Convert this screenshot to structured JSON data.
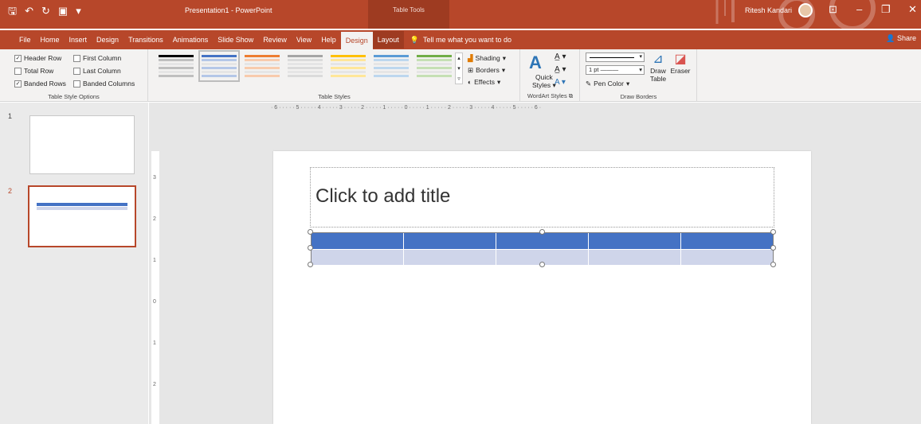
{
  "titlebar": {
    "doc_title": "Presentation1  -  PowerPoint",
    "context_title": "Table Tools",
    "user": "Ritesh Kandari"
  },
  "tabs": [
    "File",
    "Home",
    "Insert",
    "Design",
    "Transitions",
    "Animations",
    "Slide Show",
    "Review",
    "View",
    "Help",
    "Design",
    "Layout"
  ],
  "tell_me": "Tell me what you want to do",
  "share": "Share",
  "table_style_options": {
    "label": "Table Style Options",
    "items": [
      {
        "label": "Header Row",
        "checked": true
      },
      {
        "label": "First Column",
        "checked": false
      },
      {
        "label": "Total Row",
        "checked": false
      },
      {
        "label": "Last Column",
        "checked": false
      },
      {
        "label": "Banded Rows",
        "checked": true
      },
      {
        "label": "Banded Columns",
        "checked": false
      }
    ]
  },
  "table_styles": {
    "label": "Table Styles",
    "swatches": [
      {
        "color": "#000000",
        "band": "#bfbfbf"
      },
      {
        "color": "#4472c4",
        "band": "#b4c7e7"
      },
      {
        "color": "#ed7d31",
        "band": "#f8cbad"
      },
      {
        "color": "#a5a5a5",
        "band": "#dbdbdb"
      },
      {
        "color": "#ffc000",
        "band": "#ffe699"
      },
      {
        "color": "#5b9bd5",
        "band": "#bdd7ee"
      },
      {
        "color": "#70ad47",
        "band": "#c5e0b4"
      }
    ],
    "shading": "Shading",
    "borders": "Borders",
    "effects": "Effects"
  },
  "wordart": {
    "label": "WordArt Styles",
    "quick": "Quick",
    "styles": "Styles"
  },
  "draw_borders": {
    "label": "Draw Borders",
    "pen_weight": "1 pt",
    "pen_color": "Pen Color",
    "draw": "Draw",
    "table": "Table",
    "eraser": "Eraser"
  },
  "slides": [
    {
      "number": "1"
    },
    {
      "number": "2"
    }
  ],
  "ruler_h": "· 6 · · · · · 5 · · · · · 4 · · · · · 3 · · · · · 2 · · · · · 1 · · · · · 0 · · · · · 1 · · · · · 2 · · · · · 3 · · · · · 4 · · · · · 5 · · · · · 6 ·",
  "slide": {
    "title_placeholder": "Click to add title"
  },
  "colors": {
    "accent": "#b7472a",
    "table_header": "#4472c4",
    "table_band": "#cfd5ea"
  }
}
